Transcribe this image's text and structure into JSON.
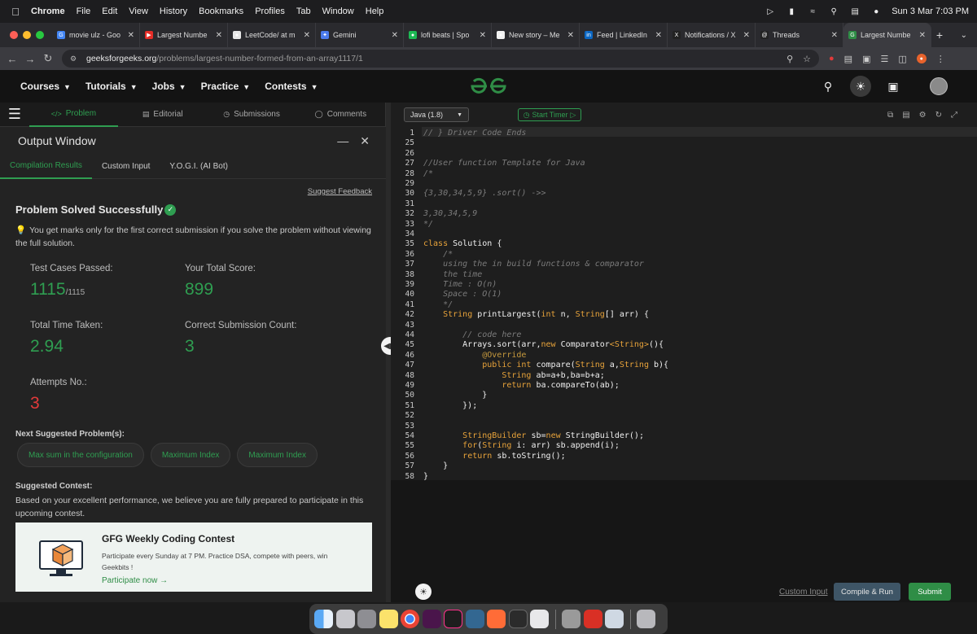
{
  "menubar": {
    "items": [
      "Chrome",
      "File",
      "Edit",
      "View",
      "History",
      "Bookmarks",
      "Profiles",
      "Tab",
      "Window",
      "Help"
    ],
    "datetime": "Sun 3 Mar  7:03 PM"
  },
  "tabs": [
    {
      "label": "movie ulz - Goo",
      "fav_color": "#4285f4",
      "fav": "G"
    },
    {
      "label": "Largest Numbe",
      "fav_color": "#e52d27",
      "fav": "▶"
    },
    {
      "label": "LeetCode/ at m",
      "fav_color": "#e8e8e8",
      "fav": "●"
    },
    {
      "label": "Gemini",
      "fav_color": "#4b7bec",
      "fav": "✦"
    },
    {
      "label": "lofi beats | Spo",
      "fav_color": "#1db954",
      "fav": "●"
    },
    {
      "label": "New story – Me",
      "fav_color": "#f2f2f2",
      "fav": "●"
    },
    {
      "label": "Feed | LinkedIn",
      "fav_color": "#0a66c2",
      "fav": "in"
    },
    {
      "label": "Notifications / X",
      "fav_color": "#222",
      "fav": "X"
    },
    {
      "label": "Threads",
      "fav_color": "#222",
      "fav": "@"
    },
    {
      "label": "Largest Numbe",
      "fav_color": "#2f8d46",
      "fav": "G"
    }
  ],
  "address": {
    "domain": "geeksforgeeks.org",
    "path": "/problems/largest-number-formed-from-an-array1117/1"
  },
  "gfg": {
    "nav": [
      "Courses",
      "Tutorials",
      "Jobs",
      "Practice",
      "Contests"
    ],
    "logo": "GG"
  },
  "left_tabs": [
    "Problem",
    "Editorial",
    "Submissions",
    "Comments"
  ],
  "output": {
    "title": "Output Window",
    "tabs": [
      "Compilation Results",
      "Custom Input",
      "Y.O.G.I. (AI Bot)"
    ],
    "suggest_feedback": "Suggest Feedback",
    "solved": "Problem Solved Successfully",
    "tip": "You get marks only for the first correct submission if you solve the problem without viewing the full solution.",
    "stats": {
      "test_cases_label": "Test Cases Passed:",
      "test_cases_value": "1115",
      "test_cases_total": "/1115",
      "score_label": "Your Total Score:",
      "score_value": "899",
      "time_label": "Total Time Taken:",
      "time_value": "2.94",
      "correct_label": "Correct Submission Count:",
      "correct_value": "3",
      "attempts_label": "Attempts No.:",
      "attempts_value": "3"
    },
    "next_label": "Next Suggested Problem(s):",
    "next_problems": [
      "Max sum in the configuration",
      "Maximum Index",
      "Maximum Index"
    ],
    "contest_label": "Suggested Contest:",
    "contest_desc": "Based on your excellent performance, we believe you are fully prepared to participate in this upcoming contest.",
    "banner": {
      "title": "GFG Weekly Coding Contest",
      "desc": "Participate every Sunday at 7 PM. Practice DSA, compete with peers, win Geekbits !",
      "link": "Participate now →"
    }
  },
  "editor": {
    "language": "Java (1.8)",
    "timer": "Start Timer",
    "line_numbers": [
      "1",
      "25",
      "26",
      "27",
      "28",
      "29",
      "30",
      "31",
      "32",
      "33",
      "34",
      "35",
      "36",
      "37",
      "38",
      "39",
      "40",
      "41",
      "42",
      "43",
      "44",
      "45",
      "46",
      "47",
      "48",
      "49",
      "50",
      "51",
      "52",
      "53",
      "54",
      "55",
      "56",
      "57",
      "58"
    ],
    "custom_input": "Custom Input",
    "compile_run": "Compile & Run",
    "submit": "Submit"
  }
}
